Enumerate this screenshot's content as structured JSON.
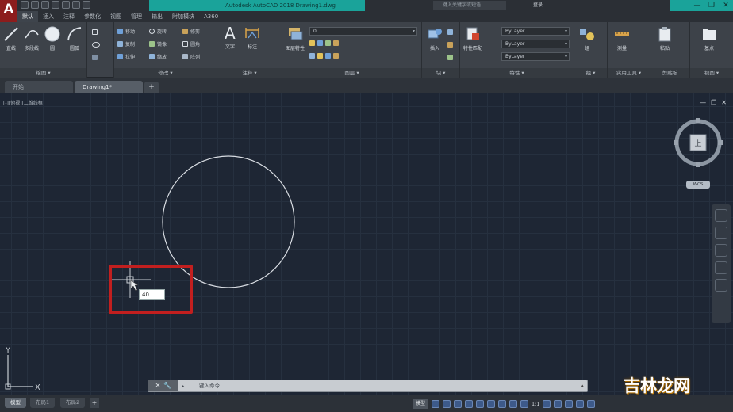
{
  "app": {
    "logo_letter": "A",
    "title": "Autodesk AutoCAD 2018    Drawing1.dwg",
    "search_placeholder": "键入关键字或短语",
    "login": "登录",
    "window_controls": [
      "—",
      "❐",
      "✕"
    ]
  },
  "ribbon_tabs": [
    "默认",
    "插入",
    "注释",
    "参数化",
    "视图",
    "管理",
    "输出",
    "附加模块",
    "A360"
  ],
  "ribbon_active_tab": "默认",
  "ribbon": {
    "draw": {
      "title": "绘图 ▾",
      "tools": [
        "直线",
        "多段线",
        "圆",
        "圆弧"
      ]
    },
    "modify": {
      "title": "修改 ▾",
      "tools": [
        "移动",
        "旋转",
        "修剪",
        "复制",
        "镜像",
        "圆角",
        "拉伸",
        "缩放",
        "阵列"
      ]
    },
    "annotation": {
      "title": "注释 ▾",
      "tools": [
        "文字",
        "标注"
      ]
    },
    "layers": {
      "title": "图层 ▾",
      "tools": [
        "图层特性"
      ],
      "layer_value": "0"
    },
    "block": {
      "title": "块 ▾",
      "tools": [
        "插入"
      ]
    },
    "properties": {
      "title": "特性 ▾",
      "tools": [
        "特性匹配"
      ],
      "color": "ByLayer",
      "linetype": "ByLayer",
      "lineweight": "ByLayer"
    },
    "groups": {
      "title": "组 ▾",
      "tools": [
        "组"
      ]
    },
    "utilities": {
      "title": "实用工具 ▾",
      "tools": [
        "测量"
      ]
    },
    "clipboard": {
      "title": "剪贴板",
      "tools": [
        "粘贴"
      ]
    },
    "view": {
      "title": "视图 ▾",
      "tools": [
        "基点"
      ]
    }
  },
  "file_tabs": [
    "开始",
    "Drawing1*"
  ],
  "file_tab_active": "Drawing1*",
  "file_tab_add": "+",
  "viewport": {
    "label": "[-][俯视][二维线框]",
    "controls": [
      "—",
      "❐",
      "✕"
    ],
    "viewcube_face": "上",
    "wcs_label": "WCS",
    "dynamic_input_value": "40",
    "ucs_y": "Y",
    "ucs_x": "X"
  },
  "command_line": {
    "buttons": [
      "✕",
      "🔧"
    ],
    "prompt_icon": "▸",
    "placeholder": "键入命令"
  },
  "layout_tabs": [
    "模型",
    "布局1",
    "布局2"
  ],
  "layout_active": "模型",
  "layout_add": "+",
  "status": {
    "model_label": "模型",
    "scale": "1:1"
  },
  "watermark": {
    "text": "吉林龙网"
  },
  "colors": {
    "canvas_bg": "#1e2634",
    "circle": "#d9dde3",
    "highlight": "#c21f1f",
    "title_accent": "#1aa39a"
  }
}
